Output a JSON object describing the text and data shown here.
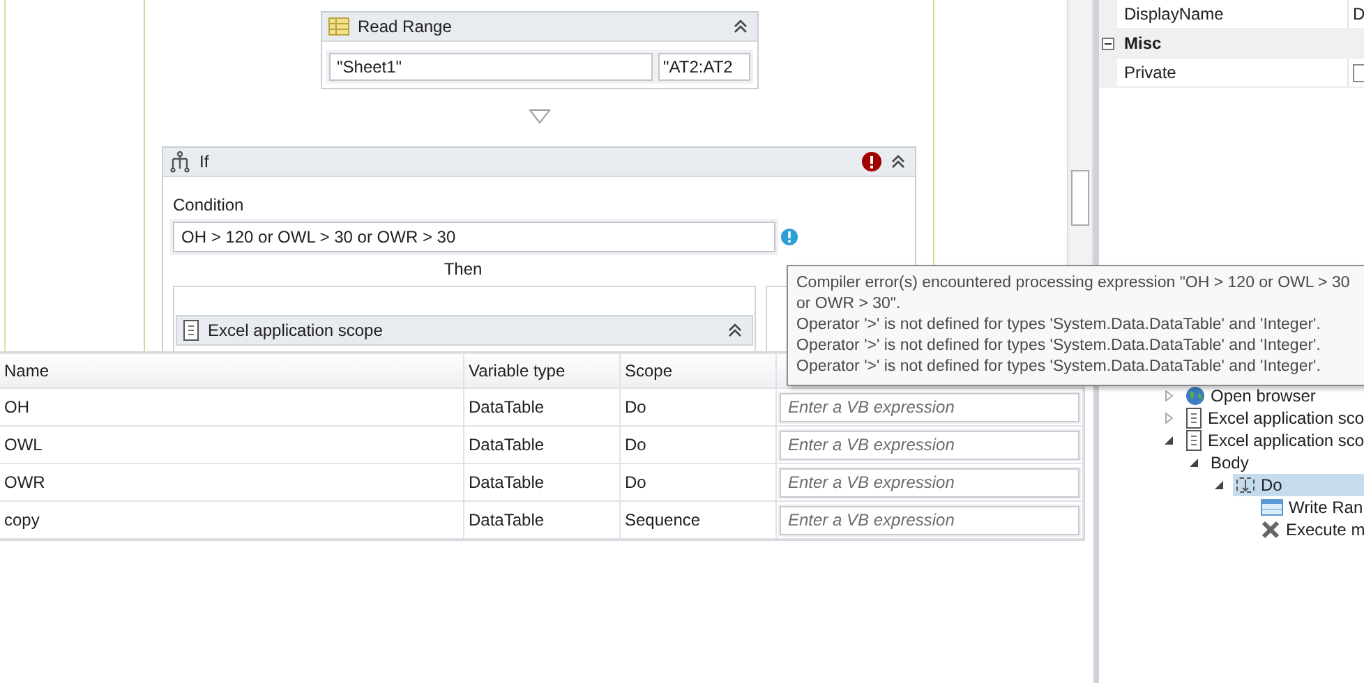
{
  "designer": {
    "read_range": {
      "title": "Read Range",
      "sheet": "\"Sheet1\"",
      "range": "\"AT2:AT2"
    },
    "if_activity": {
      "title": "If",
      "has_error": true,
      "condition_label": "Condition",
      "condition": "OH > 120 or OWL > 30 or OWR > 30",
      "condition_error": true,
      "then_label": "Then",
      "then_activity": {
        "title": "Excel application scope"
      }
    }
  },
  "variables": {
    "columns": [
      "Name",
      "Variable type",
      "Scope"
    ],
    "rows": [
      {
        "name": "OH",
        "type": "DataTable",
        "scope": "Do",
        "default_placeholder": "Enter a VB expression"
      },
      {
        "name": "OWL",
        "type": "DataTable",
        "scope": "Do",
        "default_placeholder": "Enter a VB expression"
      },
      {
        "name": "OWR",
        "type": "DataTable",
        "scope": "Do",
        "default_placeholder": "Enter a VB expression"
      },
      {
        "name": "copy",
        "type": "DataTable",
        "scope": "Sequence",
        "default_placeholder": "Enter a VB expression"
      }
    ]
  },
  "properties": {
    "rows": [
      {
        "kind": "property",
        "name": "DisplayName",
        "value": "D"
      },
      {
        "kind": "category",
        "name": "Misc",
        "expanded": true
      },
      {
        "kind": "checkbox",
        "name": "Private",
        "checked": false
      }
    ]
  },
  "outline": {
    "items": [
      {
        "label": "Open browser",
        "kind": "globe",
        "expanded": false,
        "selected": false
      },
      {
        "label": "Excel application sco",
        "kind": "document",
        "expanded": false,
        "selected": false
      },
      {
        "label": "Excel application sco",
        "kind": "document",
        "expanded": true,
        "selected": false,
        "children": [
          {
            "label": "Body",
            "expanded": true,
            "selected": false,
            "children": [
              {
                "label": "Do",
                "kind": "sequence",
                "expanded": true,
                "selected": true,
                "children": [
                  {
                    "label": "Write Ran",
                    "kind": "table",
                    "selected": false
                  },
                  {
                    "label": "Execute m",
                    "kind": "execute",
                    "selected": false
                  }
                ]
              }
            ]
          }
        ]
      }
    ]
  },
  "tooltip": {
    "message": "Compiler error(s) encountered processing expression \"OH > 120 or OWL > 30 or OWR > 30\".",
    "errors": [
      "Operator '>' is not defined for types 'System.Data.DataTable' and 'Integer'.",
      "Operator '>' is not defined for types 'System.Data.DataTable' and 'Integer'.",
      "Operator '>' is not defined for types 'System.Data.DataTable' and 'Integer'."
    ]
  }
}
